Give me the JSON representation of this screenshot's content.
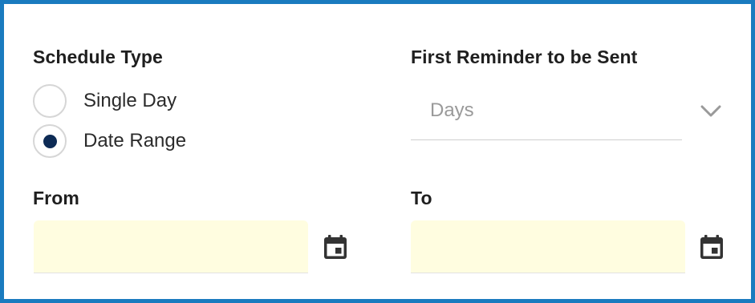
{
  "schedule_type": {
    "label": "Schedule Type",
    "options": [
      {
        "label": "Single Day",
        "selected": false
      },
      {
        "label": "Date Range",
        "selected": true
      }
    ]
  },
  "first_reminder": {
    "label": "First Reminder to be Sent",
    "value": "Days",
    "icon": "chevron-down-icon"
  },
  "from": {
    "label": "From",
    "value": "",
    "icon": "calendar-icon"
  },
  "to": {
    "label": "To",
    "value": "",
    "icon": "calendar-icon"
  },
  "colors": {
    "frame_border": "#1a7bbf",
    "radio_selected": "#0d2b55",
    "input_background": "#fffde0",
    "placeholder_text": "#9a9a9a"
  }
}
